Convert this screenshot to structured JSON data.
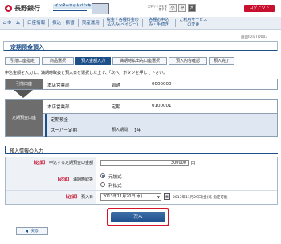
{
  "header": {
    "bank_name": "長野銀行",
    "ib_label": "インターネットバンキング",
    "font_size_label": "文字サイズを変更する",
    "font_small": "小",
    "font_medium": "中",
    "font_large": "大",
    "logout": "ログアウト"
  },
  "nav": {
    "home": "ホーム",
    "items": [
      "口座情報",
      "振込・振替",
      "資産運用",
      "税金・各種料金の払込み(ペイジー)",
      "各種お申込み・手続き",
      "ご利用サービスの変更"
    ]
  },
  "screen_id": "画面ID:BTD003",
  "page_title": "定期預金預入",
  "steps": [
    "引落口座指定",
    "商品選択",
    "預入金額入力",
    "満期時払出先口座選択",
    "預入内容確認",
    "預入完了"
  ],
  "current_step": 2,
  "instruction": "申込金額を入力し、満期時取扱と預入日を選択した上で、「次へ」ボタンを押して下さい。",
  "from_account": {
    "label": "引落口座",
    "branch": "本店営業部",
    "type": "普通",
    "number": "0000000"
  },
  "to_account": {
    "label": "定期預金口座",
    "branch": "本店営業部",
    "type": "定期",
    "number": "0100001",
    "category": "定期預金",
    "product": "スーパー定期",
    "term_label": "預入期間",
    "term": "1年"
  },
  "section_title": "預入情報の入力",
  "form": {
    "required": "【必須】",
    "amount_label": "申込する定期預金の金額",
    "amount_value": "300000",
    "amount_unit": "円",
    "maturity_label": "満期時取扱",
    "maturity_options": [
      "元加式",
      "利払式"
    ],
    "maturity_selected": 0,
    "date_label": "預入日",
    "date_value": "2013年11月20日(水)",
    "calendar": "カレンダー",
    "date_note": "2013年11月29日(金)迄 指定可能"
  },
  "buttons": {
    "next": "次へ",
    "back": "戻る"
  },
  "colors": {
    "brand_red": "#c8102e",
    "navy": "#1d4f8a",
    "label_gray": "#6d6d6d",
    "highlight": "#d3142b"
  }
}
